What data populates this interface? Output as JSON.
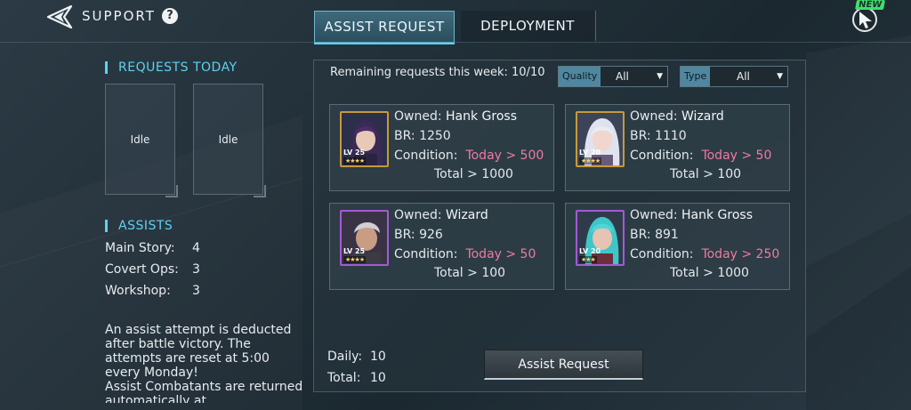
{
  "header": {
    "title": "SUPPORT",
    "help_glyph": "?",
    "new_badge": "NEW"
  },
  "tabs": [
    {
      "label": "ASSIST REQUEST",
      "active": true
    },
    {
      "label": "DEPLOYMENT",
      "active": false
    }
  ],
  "requests_today": {
    "title": "REQUESTS TODAY",
    "slots": [
      "Idle",
      "Idle"
    ]
  },
  "assists": {
    "title": "ASSISTS",
    "rows": [
      {
        "label": "Main Story:",
        "value": "4"
      },
      {
        "label": "Covert Ops:",
        "value": "3"
      },
      {
        "label": "Workshop:",
        "value": "3"
      }
    ],
    "note": "An assist attempt is deducted after battle victory. The attempts are reset at 5:00 every Monday!\nAssist Combatants are returned automatically at"
  },
  "panel": {
    "remaining_label": "Remaining requests this week:",
    "remaining_value": "10/10",
    "filters": [
      {
        "label": "Quality",
        "value": "All"
      },
      {
        "label": "Type",
        "value": "All"
      }
    ],
    "cards": [
      {
        "owned_label": "Owned:",
        "owned": "Hank Gross",
        "br_label": "BR:",
        "br": "1250",
        "condition_label": "Condition:",
        "today": "Today > 500",
        "total": "Total > 1000",
        "lv": "LV 25",
        "stars": "★★★★",
        "frame": "gold"
      },
      {
        "owned_label": "Owned:",
        "owned": "Wizard",
        "br_label": "BR:",
        "br": "1110",
        "condition_label": "Condition:",
        "today": "Today > 50",
        "total": "Total > 100",
        "lv": "LV 20",
        "stars": "★★★★",
        "frame": "gold"
      },
      {
        "owned_label": "Owned:",
        "owned": "Wizard",
        "br_label": "BR:",
        "br": "926",
        "condition_label": "Condition:",
        "today": "Today > 50",
        "total": "Total > 100",
        "lv": "LV 25",
        "stars": "★★★★",
        "frame": "purple"
      },
      {
        "owned_label": "Owned:",
        "owned": "Hank Gross",
        "br_label": "BR:",
        "br": "891",
        "condition_label": "Condition:",
        "today": "Today > 250",
        "total": "Total > 1000",
        "lv": "LV 20",
        "stars": "★★★",
        "frame": "purple"
      }
    ],
    "daily_label": "Daily:",
    "daily_value": "10",
    "total_label": "Total:",
    "total_value": "10",
    "button_label": "Assist Request"
  },
  "colors": {
    "accent": "#5fd1ef",
    "condition": "#f07aa0",
    "gold_frame": "#c79a3a",
    "purple_frame": "#a35ad8"
  }
}
